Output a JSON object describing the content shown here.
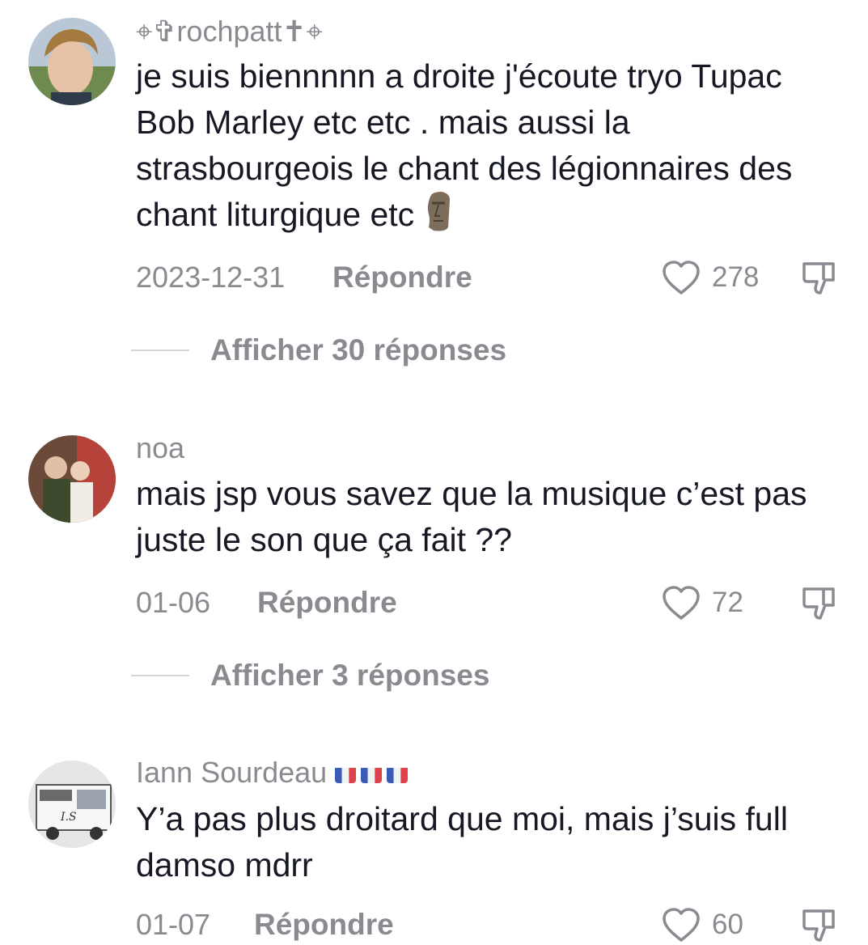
{
  "comments": [
    {
      "username": "⌖✞rochpatt✝⌖",
      "text": "je suis biennnnn a droite j'écoute tryo Tupac Bob Marley etc etc . mais aussi la strasbourgeois le chant des légionnaires des chant liturgique etc",
      "emoji_icon": "moai-icon",
      "date": "2023-12-31",
      "reply_label": "Répondre",
      "likes": "278",
      "view_replies": "Afficher 30 réponses"
    },
    {
      "username": "noa",
      "text": "mais jsp vous savez que la musique c’est pas juste le son que ça fait ??",
      "date": "01-06",
      "reply_label": "Répondre",
      "likes": "72",
      "view_replies": "Afficher 3 réponses"
    },
    {
      "username": "Iann Sourdeau",
      "flags": [
        "france-flag-icon",
        "france-flag-icon",
        "france-flag-icon"
      ],
      "text": "Y’a pas plus droitard que moi, mais j’suis full damso mdrr",
      "date": "01-07",
      "reply_label": "Répondre",
      "likes": "60"
    }
  ],
  "colors": {
    "text": "#161823",
    "secondary": "#8a8b91",
    "divider": "#d6d6d8"
  }
}
